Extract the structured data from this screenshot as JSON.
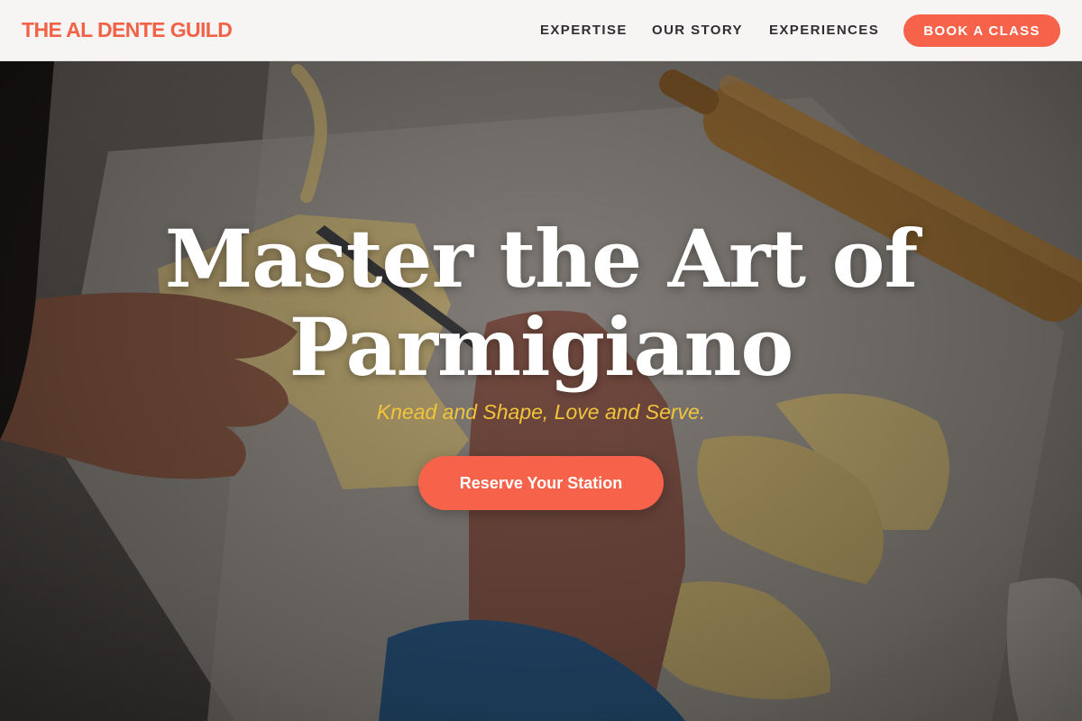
{
  "brand": {
    "name": "THE AL DENTE GUILD",
    "color": "#f26247"
  },
  "nav": {
    "items": [
      {
        "label": "EXPERTISE"
      },
      {
        "label": "OUR STORY"
      },
      {
        "label": "EXPERIENCES"
      }
    ],
    "cta_label": "BOOK A CLASS"
  },
  "hero": {
    "title_line1": "Master the Art of",
    "title_line2": "Parmigiano",
    "subtitle": "Knead and Shape, Love and Serve.",
    "cta_label": "Reserve Your Station",
    "background": "photo-pasta-making"
  },
  "colors": {
    "accent": "#f7634a",
    "subtitle": "#f2c43b",
    "nav_text": "#2f2f33",
    "navbar_bg": "#f6f5f3"
  }
}
